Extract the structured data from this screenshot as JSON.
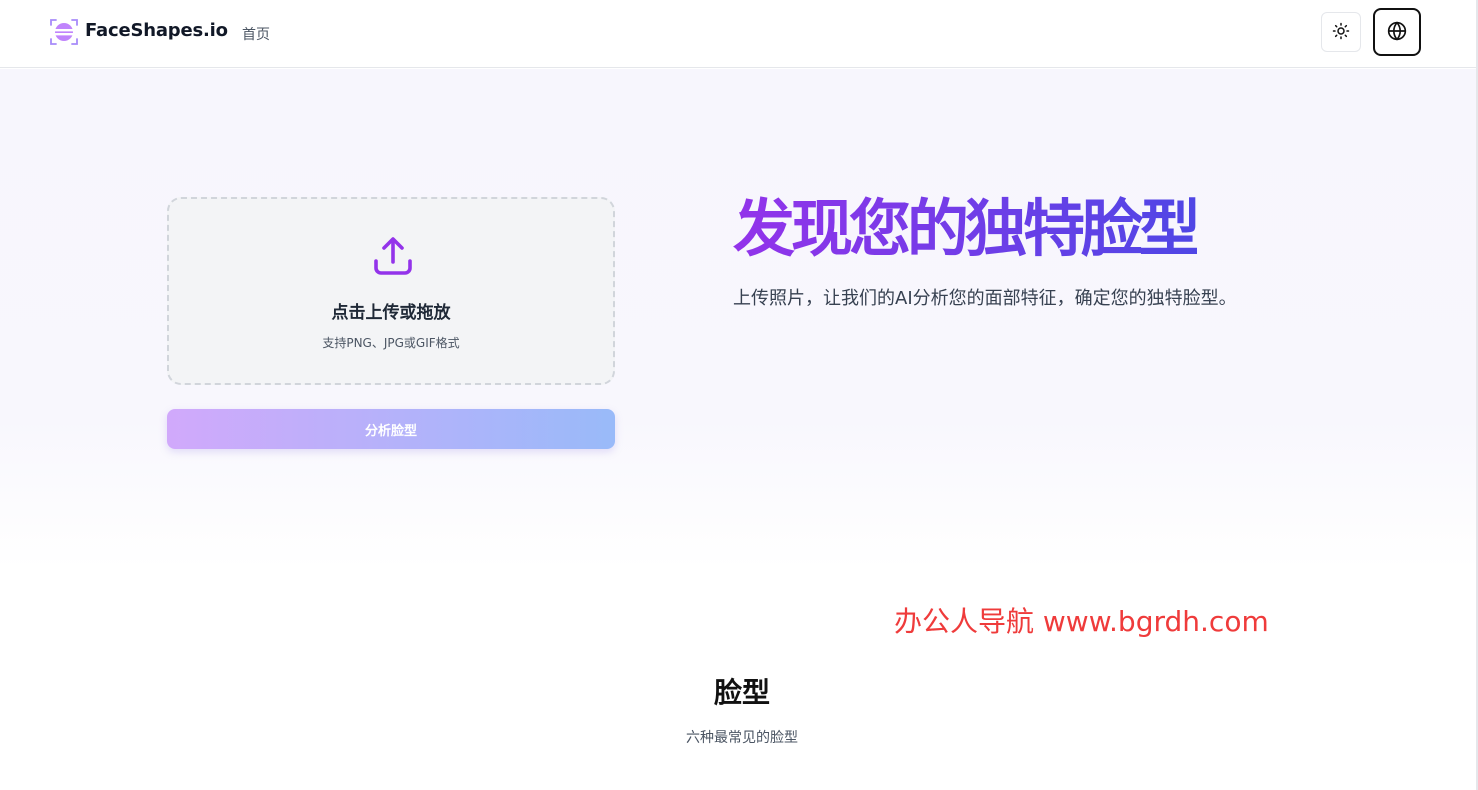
{
  "header": {
    "brand": "FaceShapes.io",
    "nav": {
      "home": "首页"
    },
    "icons": {
      "logo": "face-scan-logo",
      "theme": "sun-icon",
      "language": "globe-icon"
    }
  },
  "upload": {
    "title": "点击上传或拖放",
    "hint": "支持PNG、JPG或GIF格式",
    "icon": "upload-icon"
  },
  "analyze_button": "分析脸型",
  "hero": {
    "title": "发现您的独特脸型",
    "description": "上传照片，让我们的AI分析您的面部特征，确定您的独特脸型。"
  },
  "watermark": "办公人导航 www.bgrdh.com",
  "section": {
    "title": "脸型",
    "subtitle": "六种最常见的脸型"
  },
  "colors": {
    "accent_purple": "#9333ea",
    "accent_indigo": "#4f46e5",
    "watermark_red": "#ef3b3b"
  }
}
